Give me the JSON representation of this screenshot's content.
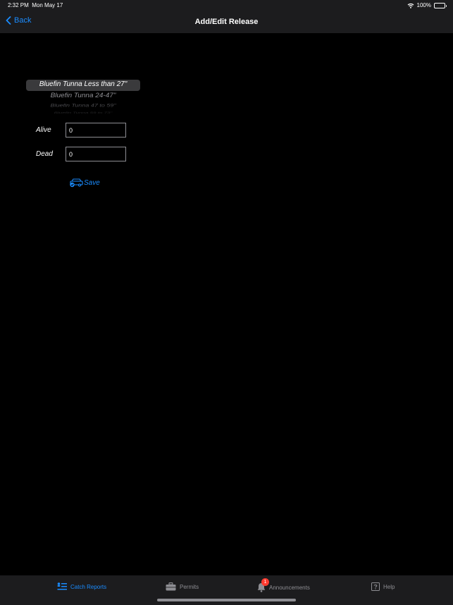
{
  "status": {
    "time": "2:32 PM",
    "date": "Mon May 17",
    "battery": "100%"
  },
  "nav": {
    "back_label": "Back",
    "title": "Add/Edit Release"
  },
  "picker": {
    "rows": [
      "Bluefin Tunna Less than 27\"",
      "Bluefin Tunna 24-47\"",
      "Bluefin Tunna 47 to 59\"",
      "Bluefin Tunna 59 to 73\""
    ],
    "selected_index": 0
  },
  "form": {
    "alive_label": "Alive",
    "alive_value": "0",
    "dead_label": "Dead",
    "dead_value": "0",
    "save_label": "Save"
  },
  "tabs": {
    "items": [
      {
        "label": "Catch Reports",
        "icon": "catch-reports-icon",
        "active": true
      },
      {
        "label": "Permits",
        "icon": "briefcase-icon",
        "active": false
      },
      {
        "label": "Announcements",
        "icon": "bell-icon",
        "active": false,
        "badge": "1"
      },
      {
        "label": "Help",
        "icon": "question-icon",
        "active": false
      }
    ]
  },
  "colors": {
    "accent": "#1a8cff",
    "background": "#000000",
    "bar": "#1c1c1e",
    "badge": "#ff3b30",
    "inactive": "#8e8e93"
  }
}
